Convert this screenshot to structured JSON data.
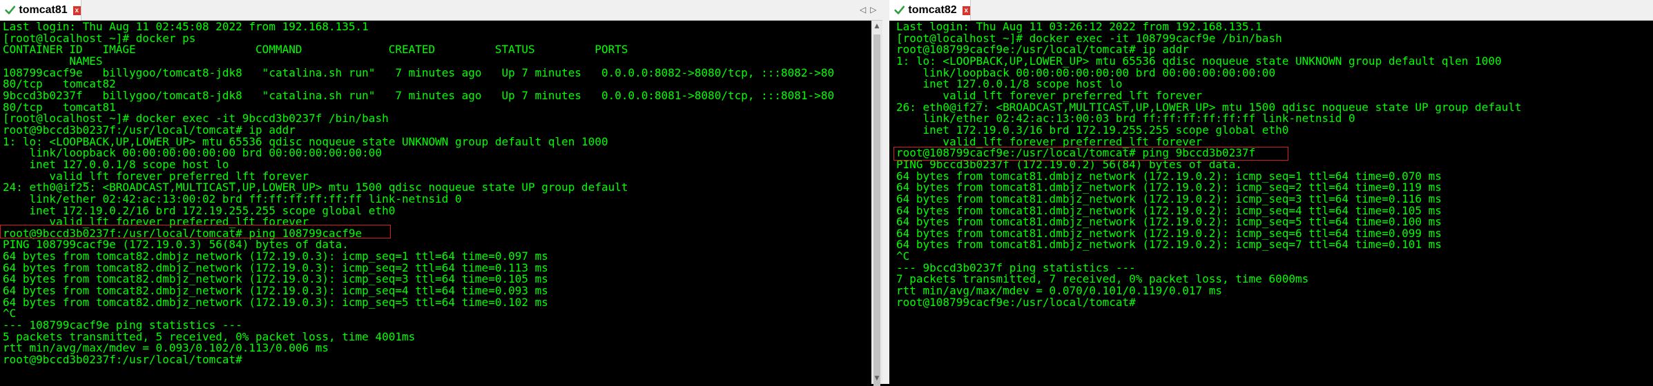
{
  "left": {
    "tab_title": "tomcat81",
    "close_symbol": "x",
    "lines": [
      "Last login: Thu Aug 11 02:45:08 2022 from 192.168.135.1",
      "[root@localhost ~]# docker ps",
      "CONTAINER ID   IMAGE                  COMMAND             CREATED         STATUS         PORTS",
      "          NAMES",
      "108799cacf9e   billygoo/tomcat8-jdk8   \"catalina.sh run\"   7 minutes ago   Up 7 minutes   0.0.0.0:8082->8080/tcp, :::8082->80",
      "80/tcp   tomcat82",
      "9bccd3b0237f   billygoo/tomcat8-jdk8   \"catalina.sh run\"   7 minutes ago   Up 7 minutes   0.0.0.0:8081->8080/tcp, :::8081->80",
      "80/tcp   tomcat81",
      "[root@localhost ~]# docker exec -it 9bccd3b0237f /bin/bash",
      "root@9bccd3b0237f:/usr/local/tomcat# ip addr",
      "1: lo: <LOOPBACK,UP,LOWER_UP> mtu 65536 qdisc noqueue state UNKNOWN group default qlen 1000",
      "    link/loopback 00:00:00:00:00:00 brd 00:00:00:00:00:00",
      "    inet 127.0.0.1/8 scope host lo",
      "       valid_lft forever preferred_lft forever",
      "24: eth0@if25: <BROADCAST,MULTICAST,UP,LOWER_UP> mtu 1500 qdisc noqueue state UP group default",
      "    link/ether 02:42:ac:13:00:02 brd ff:ff:ff:ff:ff:ff link-netnsid 0",
      "    inet 172.19.0.2/16 brd 172.19.255.255 scope global eth0",
      "       valid_lft forever preferred_lft forever",
      "root@9bccd3b0237f:/usr/local/tomcat# ping 108799cacf9e",
      "PING 108799cacf9e (172.19.0.3) 56(84) bytes of data.",
      "64 bytes from tomcat82.dmbjz_network (172.19.0.3): icmp_seq=1 ttl=64 time=0.097 ms",
      "64 bytes from tomcat82.dmbjz_network (172.19.0.3): icmp_seq=2 ttl=64 time=0.113 ms",
      "64 bytes from tomcat82.dmbjz_network (172.19.0.3): icmp_seq=3 ttl=64 time=0.105 ms",
      "64 bytes from tomcat82.dmbjz_network (172.19.0.3): icmp_seq=4 ttl=64 time=0.093 ms",
      "64 bytes from tomcat82.dmbjz_network (172.19.0.3): icmp_seq=5 ttl=64 time=0.102 ms",
      "^C",
      "--- 108799cacf9e ping statistics ---",
      "5 packets transmitted, 5 received, 0% packet loss, time 4001ms",
      "rtt min/avg/max/mdev = 0.093/0.102/0.113/0.006 ms",
      "root@9bccd3b0237f:/usr/local/tomcat# "
    ]
  },
  "right": {
    "tab_title": "tomcat82",
    "close_symbol": "x",
    "lines": [
      "Last login: Thu Aug 11 03:26:12 2022 from 192.168.135.1",
      "[root@localhost ~]# docker exec -it 108799cacf9e /bin/bash",
      "root@108799cacf9e:/usr/local/tomcat# ip addr",
      "1: lo: <LOOPBACK,UP,LOWER_UP> mtu 65536 qdisc noqueue state UNKNOWN group default qlen 1000",
      "    link/loopback 00:00:00:00:00:00 brd 00:00:00:00:00:00",
      "    inet 127.0.0.1/8 scope host lo",
      "       valid_lft forever preferred_lft forever",
      "26: eth0@if27: <BROADCAST,MULTICAST,UP,LOWER_UP> mtu 1500 qdisc noqueue state UP group default",
      "    link/ether 02:42:ac:13:00:03 brd ff:ff:ff:ff:ff:ff link-netnsid 0",
      "    inet 172.19.0.3/16 brd 172.19.255.255 scope global eth0",
      "       valid_lft forever preferred_lft forever",
      "root@108799cacf9e:/usr/local/tomcat# ping 9bccd3b0237f",
      "PING 9bccd3b0237f (172.19.0.2) 56(84) bytes of data.",
      "64 bytes from tomcat81.dmbjz_network (172.19.0.2): icmp_seq=1 ttl=64 time=0.070 ms",
      "64 bytes from tomcat81.dmbjz_network (172.19.0.2): icmp_seq=2 ttl=64 time=0.119 ms",
      "64 bytes from tomcat81.dmbjz_network (172.19.0.2): icmp_seq=3 ttl=64 time=0.116 ms",
      "64 bytes from tomcat81.dmbjz_network (172.19.0.2): icmp_seq=4 ttl=64 time=0.105 ms",
      "64 bytes from tomcat81.dmbjz_network (172.19.0.2): icmp_seq=5 ttl=64 time=0.100 ms",
      "64 bytes from tomcat81.dmbjz_network (172.19.0.2): icmp_seq=6 ttl=64 time=0.099 ms",
      "64 bytes from tomcat81.dmbjz_network (172.19.0.2): icmp_seq=7 ttl=64 time=0.101 ms",
      "^C",
      "--- 9bccd3b0237f ping statistics ---",
      "7 packets transmitted, 7 received, 0% packet loss, time 6000ms",
      "rtt min/avg/max/mdev = 0.070/0.101/0.119/0.017 ms",
      "root@108799cacf9e:/usr/local/tomcat# "
    ]
  },
  "colors": {
    "terminal_text": "#00ff00",
    "terminal_bg": "#000000",
    "highlight_border": "#d21e1e",
    "tab_check": "#2ea043",
    "tab_close_bg": "#d9342b"
  },
  "icons": {
    "tab_status": "checkmark-icon",
    "tab_close": "close-icon",
    "nav_prev": "chevron-left-icon",
    "nav_next": "chevron-right-icon"
  }
}
